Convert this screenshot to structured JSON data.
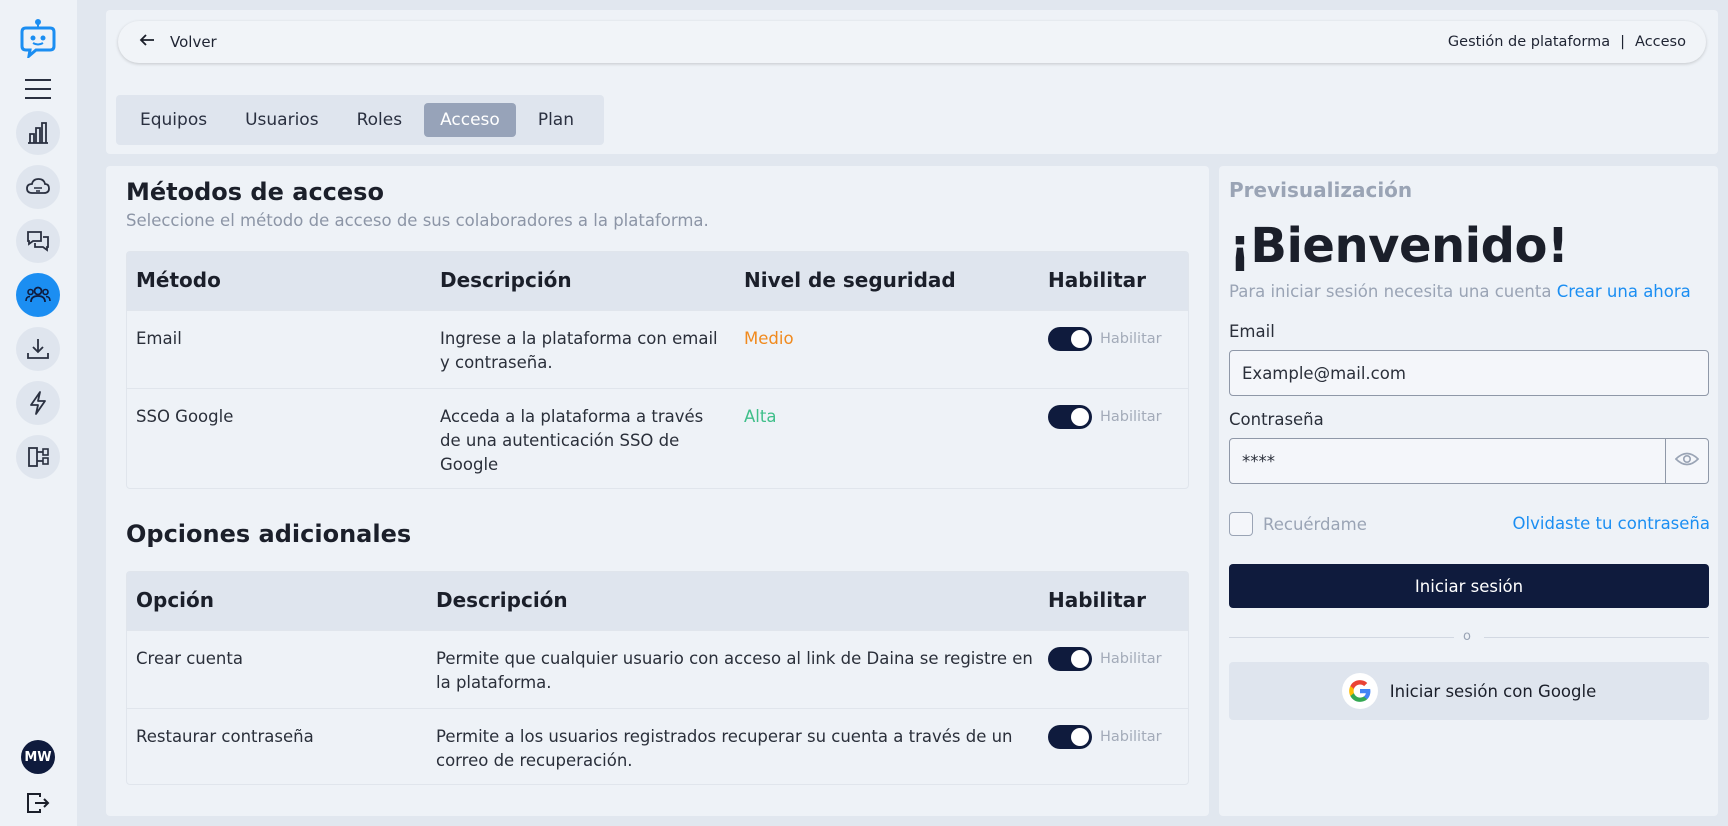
{
  "nav": {
    "breadcrumb_section": "Gestión de plataforma",
    "breadcrumb_separator": "|",
    "breadcrumb_current": "Acceso",
    "back_label": "Volver"
  },
  "sidebar": {
    "icons": [
      "logo-icon",
      "menu-icon",
      "chart-icon",
      "cloud-icon",
      "chat-icon",
      "users-icon",
      "download-icon",
      "bolt-icon",
      "flow-icon"
    ],
    "avatar_initials": "MW"
  },
  "tabs": [
    {
      "label": "Equipos",
      "active": false
    },
    {
      "label": "Usuarios",
      "active": false
    },
    {
      "label": "Roles",
      "active": false
    },
    {
      "label": "Acceso",
      "active": true
    },
    {
      "label": "Plan",
      "active": false
    }
  ],
  "methods": {
    "title": "Métodos de acceso",
    "subtitle": "Seleccione el método de acceso de sus colaboradores a la plataforma.",
    "headers": {
      "method": "Método",
      "description": "Descripción",
      "level": "Nivel de seguridad",
      "enable": "Habilitar"
    },
    "rows": [
      {
        "method": "Email",
        "desc1": "Ingrese a la plataforma con email",
        "desc2": "y contraseña.",
        "desc3": "",
        "level": "Medio",
        "enabled": true,
        "toggle_label": "Habilitar"
      },
      {
        "method": "SSO Google",
        "desc1": "Acceda a la plataforma a través",
        "desc2": "de una autenticación SSO de",
        "desc3": "Google",
        "level": "Alta",
        "enabled": true,
        "toggle_label": "Habilitar"
      }
    ]
  },
  "options": {
    "title": "Opciones adicionales",
    "headers": {
      "option": "Opción",
      "description": "Descripción",
      "enable": "Habilitar"
    },
    "rows": [
      {
        "option": "Crear cuenta",
        "desc1": "Permite que cualquier usuario con acceso al link de Daina se registre en",
        "desc2": "la plataforma.",
        "enabled": true,
        "toggle_label": "Habilitar"
      },
      {
        "option": "Restaurar contraseña",
        "desc1": "Permite a los usuarios registrados recuperar su cuenta a través de un",
        "desc2": "correo de recuperación.",
        "enabled": true,
        "toggle_label": "Habilitar"
      }
    ]
  },
  "preview": {
    "title": "Previsualización",
    "welcome": "¡Bienvenido!",
    "need_account": "Para iniciar sesión necesita una cuenta",
    "create_link": "Crear una ahora",
    "email_label": "Email",
    "email_value": "Example@mail.com",
    "password_label": "Contraseña",
    "password_value": "****",
    "remember_label": "Recuérdame",
    "forgot_label": "Olvidaste tu contraseña",
    "login_button": "Iniciar sesión",
    "divider_text": "o",
    "google_button": "Iniciar sesión con Google"
  },
  "colors": {
    "accent": "#1b8ef2",
    "primary_dark": "#0f1b3d",
    "level_medium": "#f08a1e",
    "level_high": "#3fbf8a"
  }
}
